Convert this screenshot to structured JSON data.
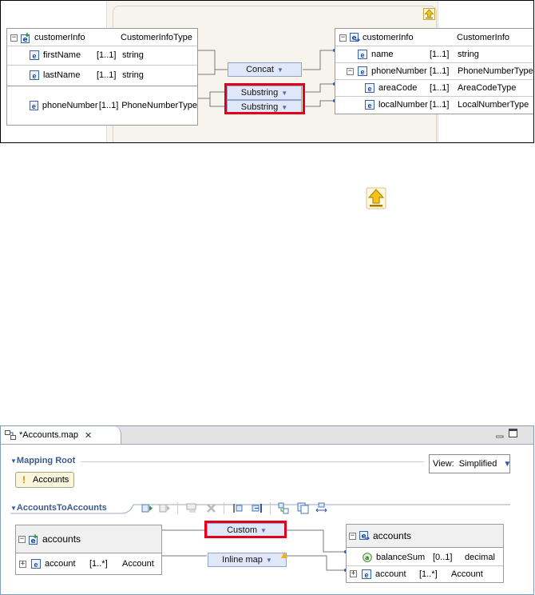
{
  "top": {
    "source": {
      "root": {
        "name": "customerInfo",
        "type": "CustomerInfoType"
      },
      "rows": [
        {
          "name": "firstName",
          "card": "[1..1]",
          "type": "string"
        },
        {
          "name": "lastName",
          "card": "[1..1]",
          "type": "string"
        },
        {
          "name": "phoneNumber",
          "card": "[1..1]",
          "type": "PhoneNumberType"
        }
      ]
    },
    "target": {
      "root": {
        "name": "customerInfo",
        "type": "CustomerInfo"
      },
      "rows": [
        {
          "name": "name",
          "card": "[1..1]",
          "type": "string"
        },
        {
          "name": "phoneNumber",
          "card": "[1..1]",
          "type": "PhoneNumberType"
        },
        {
          "name": "areaCode",
          "card": "[1..1]",
          "type": "AreaCodeType"
        },
        {
          "name": "localNumber",
          "card": "[1..1]",
          "type": "LocalNumberType"
        }
      ]
    },
    "transforms": {
      "concat": "Concat",
      "substring1": "Substring",
      "substring2": "Substring"
    }
  },
  "bottom": {
    "tab_title": "*Accounts.map",
    "mapping_root_label": "Mapping Root",
    "root_chip": "Accounts",
    "view_label": "View:",
    "view_value": "Simplified",
    "section_label": "AccountsToAccounts",
    "source": {
      "root": "accounts",
      "rows": [
        {
          "name": "account",
          "card": "[1..*]",
          "type": "Account"
        }
      ]
    },
    "target": {
      "root": "accounts",
      "rows": [
        {
          "name": "balanceSum",
          "card": "[0..1]",
          "type": "decimal"
        },
        {
          "name": "account",
          "card": "[1..*]",
          "type": "Account"
        }
      ]
    },
    "transforms": {
      "custom": "Custom",
      "inline": "Inline map"
    }
  },
  "icons": [
    "up-arrow-icon",
    "element-icon",
    "attribute-icon",
    "expand-icon",
    "collapse-icon",
    "close-icon",
    "minimize-icon",
    "maximize-icon",
    "warning-icon",
    "dropdown-icon"
  ]
}
